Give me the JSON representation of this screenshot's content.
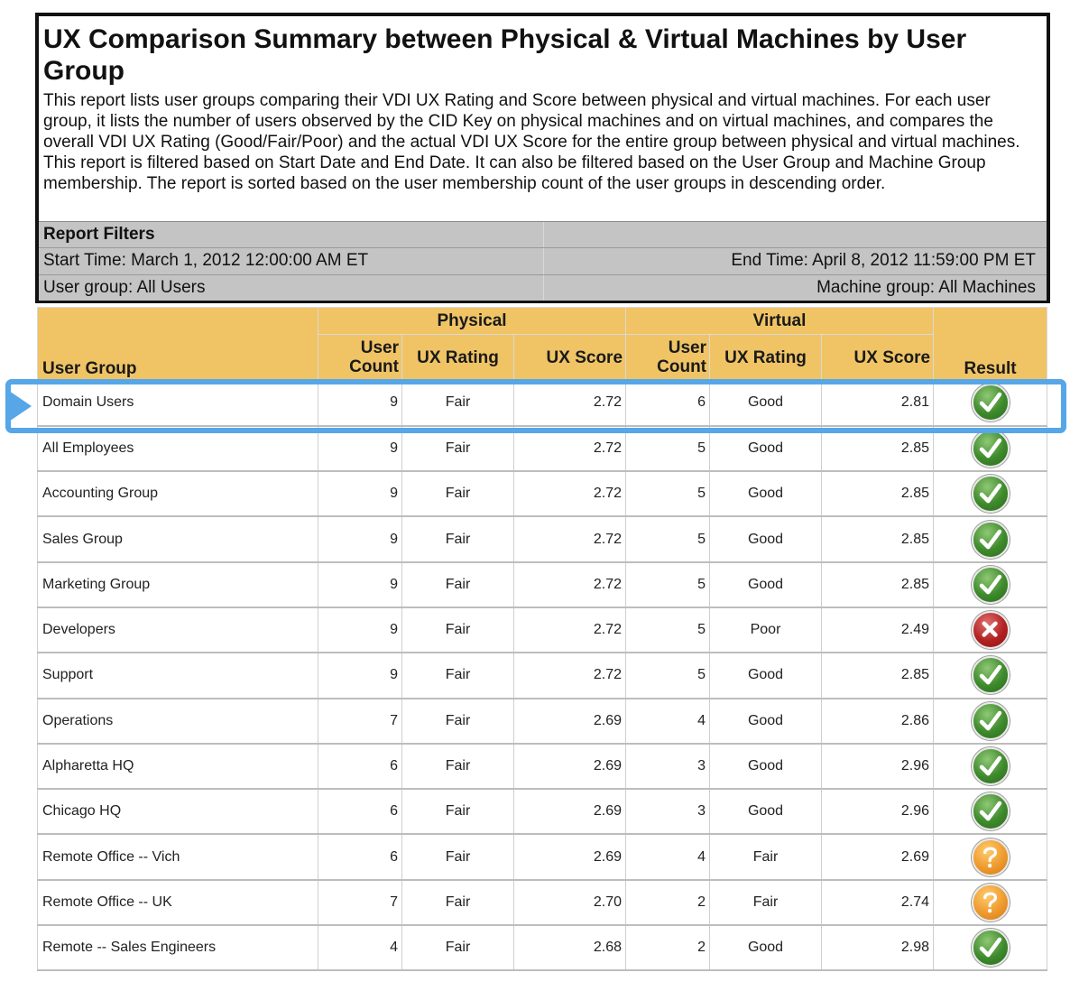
{
  "report": {
    "title": "UX Comparison Summary between Physical & Virtual Machines by User Group",
    "description_1": "This report lists user groups comparing their VDI UX Rating and Score between physical and virtual machines. For each user group, it lists the number of users observed by the CID Key on physical machines and on virtual machines, and compares the overall VDI UX Rating (Good/Fair/Poor) and the actual VDI UX Score for the entire group between physical and virtual machines.",
    "description_2": "This report is filtered based on Start Date and End Date. It can also be filtered based on the User Group and Machine Group membership. The report is sorted based on the user membership count of the user groups in descending order."
  },
  "filters": {
    "heading": "Report Filters",
    "start_time": "Start Time: March 1, 2012 12:00:00 AM ET",
    "end_time": "End Time: April 8, 2012 11:59:00 PM ET",
    "user_group": "User group: All Users",
    "machine_group": "Machine group: All Machines"
  },
  "table": {
    "group_headers": {
      "physical": "Physical",
      "virtual": "Virtual"
    },
    "columns": {
      "user_group": "User Group",
      "user_count": "User Count",
      "ux_rating": "UX Rating",
      "ux_score": "UX Score",
      "result": "Result"
    },
    "rows": [
      {
        "name": "Domain Users",
        "p_count": "9",
        "p_rating": "Fair",
        "p_score": "2.72",
        "v_count": "6",
        "v_rating": "Good",
        "v_score": "2.81",
        "result": "check-icon"
      },
      {
        "name": "All Employees",
        "p_count": "9",
        "p_rating": "Fair",
        "p_score": "2.72",
        "v_count": "5",
        "v_rating": "Good",
        "v_score": "2.85",
        "result": "check-icon"
      },
      {
        "name": "Accounting Group",
        "p_count": "9",
        "p_rating": "Fair",
        "p_score": "2.72",
        "v_count": "5",
        "v_rating": "Good",
        "v_score": "2.85",
        "result": "check-icon"
      },
      {
        "name": "Sales Group",
        "p_count": "9",
        "p_rating": "Fair",
        "p_score": "2.72",
        "v_count": "5",
        "v_rating": "Good",
        "v_score": "2.85",
        "result": "check-icon"
      },
      {
        "name": "Marketing Group",
        "p_count": "9",
        "p_rating": "Fair",
        "p_score": "2.72",
        "v_count": "5",
        "v_rating": "Good",
        "v_score": "2.85",
        "result": "check-icon"
      },
      {
        "name": "Developers",
        "p_count": "9",
        "p_rating": "Fair",
        "p_score": "2.72",
        "v_count": "5",
        "v_rating": "Poor",
        "v_score": "2.49",
        "result": "cross-icon"
      },
      {
        "name": "Support",
        "p_count": "9",
        "p_rating": "Fair",
        "p_score": "2.72",
        "v_count": "5",
        "v_rating": "Good",
        "v_score": "2.85",
        "result": "check-icon"
      },
      {
        "name": "Operations",
        "p_count": "7",
        "p_rating": "Fair",
        "p_score": "2.69",
        "v_count": "4",
        "v_rating": "Good",
        "v_score": "2.86",
        "result": "check-icon"
      },
      {
        "name": "Alpharetta HQ",
        "p_count": "6",
        "p_rating": "Fair",
        "p_score": "2.69",
        "v_count": "3",
        "v_rating": "Good",
        "v_score": "2.96",
        "result": "check-icon"
      },
      {
        "name": "Chicago HQ",
        "p_count": "6",
        "p_rating": "Fair",
        "p_score": "2.69",
        "v_count": "3",
        "v_rating": "Good",
        "v_score": "2.96",
        "result": "check-icon"
      },
      {
        "name": "Remote Office -- Vich",
        "p_count": "6",
        "p_rating": "Fair",
        "p_score": "2.69",
        "v_count": "4",
        "v_rating": "Fair",
        "v_score": "2.69",
        "result": "question-icon"
      },
      {
        "name": "Remote Office -- UK",
        "p_count": "7",
        "p_rating": "Fair",
        "p_score": "2.70",
        "v_count": "2",
        "v_rating": "Fair",
        "v_score": "2.74",
        "result": "question-icon"
      },
      {
        "name": "Remote -- Sales Engineers",
        "p_count": "4",
        "p_rating": "Fair",
        "p_score": "2.68",
        "v_count": "2",
        "v_rating": "Good",
        "v_score": "2.98",
        "result": "check-icon"
      }
    ]
  },
  "highlight": {
    "row_index": 0,
    "color": "#56a6e8"
  },
  "colors": {
    "header_bg": "#f0c465",
    "filter_bg": "#c4c4c4",
    "good": "#3e8a2c",
    "poor": "#b22121",
    "fair": "#ee9a2e"
  }
}
